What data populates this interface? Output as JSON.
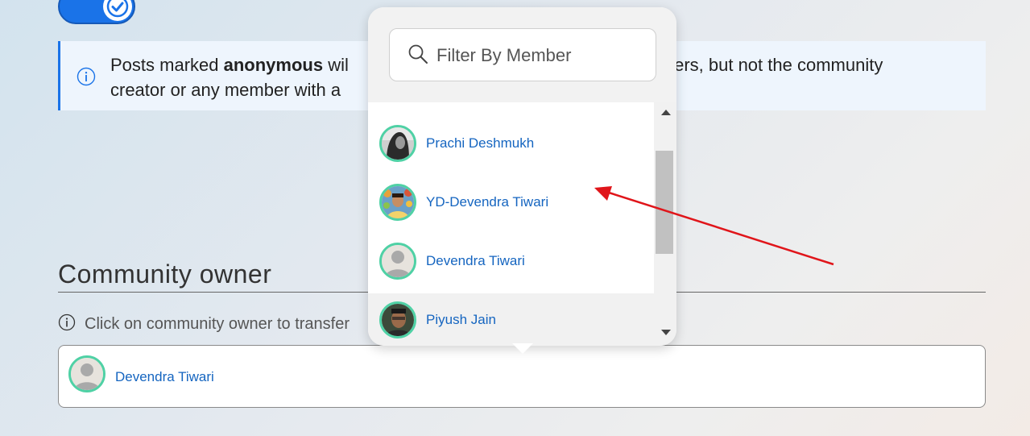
{
  "toggle": {
    "state": "on",
    "color": "#1a73e8"
  },
  "info_banner": {
    "icon": "info-icon",
    "text_before": "Posts marked ",
    "bold_word": "anonymous",
    "text_left": " wil",
    "text_right": "bers, but not the community",
    "line2": "creator or any member with a"
  },
  "community_owner": {
    "title": "Community owner",
    "hint_icon": "info-icon",
    "hint": "Click on community owner to transfer",
    "owner": {
      "name": "Devendra Tiwari",
      "avatar": "default-avatar"
    }
  },
  "member_dropdown": {
    "search_icon": "search-icon",
    "search_placeholder": "Filter By Member",
    "members": [
      {
        "name": "Prachi Deshmukh",
        "avatar": "photo-avatar"
      },
      {
        "name": "YD-Devendra Tiwari",
        "avatar": "photo-avatar"
      },
      {
        "name": "Devendra Tiwari",
        "avatar": "default-avatar"
      },
      {
        "name": "Piyush Jain",
        "avatar": "photo-avatar"
      }
    ]
  },
  "annotation": {
    "type": "arrow",
    "color": "#e0151a"
  },
  "colors": {
    "accent": "#1a73e8",
    "link": "#1565c0",
    "avatar_ring": "#4fd1a5"
  }
}
